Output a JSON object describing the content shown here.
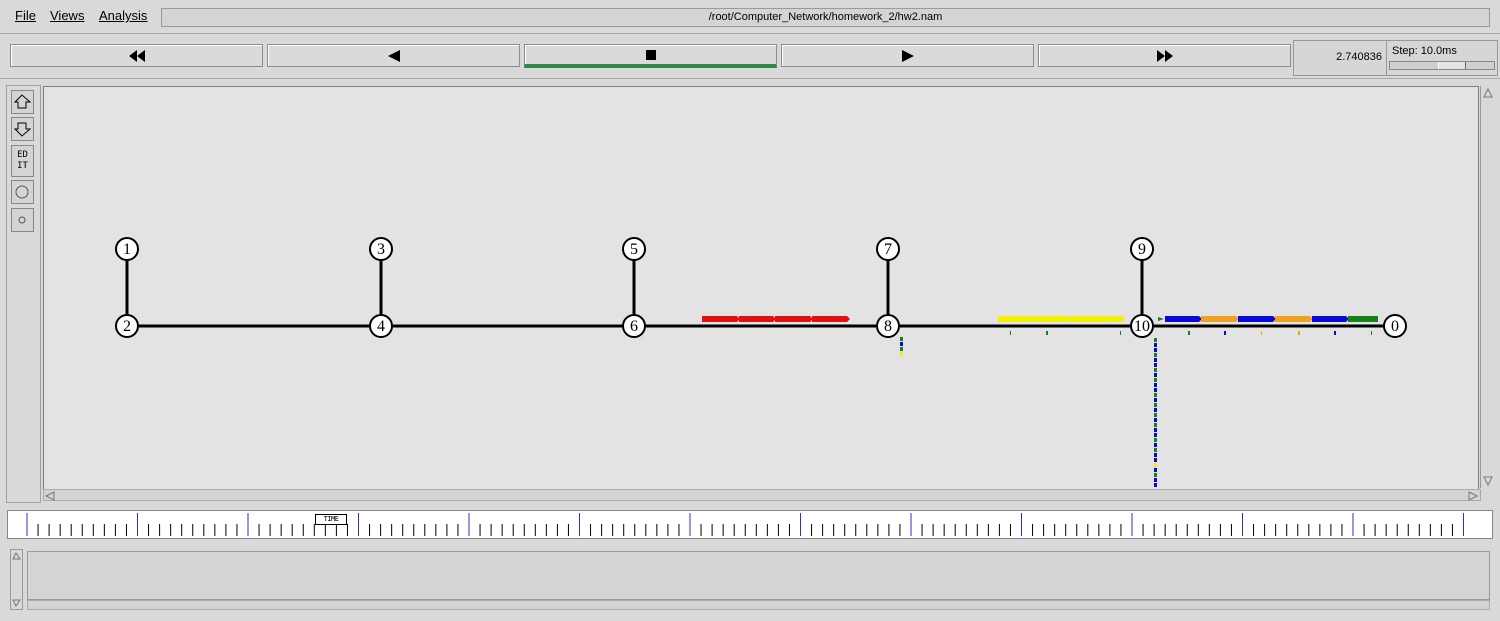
{
  "menu": {
    "file_label": "File",
    "views_label": "Views",
    "analysis_label": "Analysis"
  },
  "window": {
    "path": "/root/Computer_Network/homework_2/hw2.nam"
  },
  "controls": {
    "current_time": "2.740836",
    "step_label": "Step: 10.0ms",
    "buttons": [
      "rewind",
      "step-back",
      "stop",
      "play",
      "fast-forward"
    ]
  },
  "toolbar": {
    "edit_label_line1": "ED",
    "edit_label_line2": "IT",
    "icons": [
      "zoom-in-icon",
      "zoom-out-icon",
      "edit-icon",
      "node-circle-icon",
      "small-circle-icon"
    ]
  },
  "timeline": {
    "marker_label": "TIME"
  },
  "network": {
    "nodes": [
      "0",
      "1",
      "2",
      "3",
      "4",
      "5",
      "6",
      "7",
      "8",
      "9",
      "10"
    ],
    "packet_colors": {
      "red": "#e01010",
      "yellow": "#f2f200",
      "blue": "#0a0ad8",
      "orange": "#f2a020",
      "green": "#178017"
    }
  }
}
